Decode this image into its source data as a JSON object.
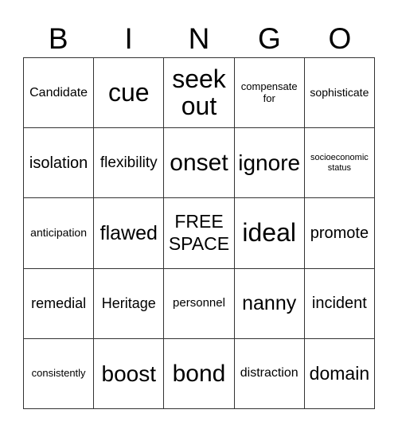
{
  "header": [
    "B",
    "I",
    "N",
    "G",
    "O"
  ],
  "cells": [
    [
      "Candidate",
      "cue",
      "seek out",
      "compensate for",
      "sophisticate"
    ],
    [
      "isolation",
      "flexibility",
      "onset",
      "ignore",
      "socioeconomic status"
    ],
    [
      "anticipation",
      "flawed",
      "FREE SPACE",
      "ideal",
      "promote"
    ],
    [
      "remedial",
      "Heritage",
      "personnel",
      "nanny",
      "incident"
    ],
    [
      "consistently",
      "boost",
      "bond",
      "distraction",
      "domain"
    ]
  ]
}
